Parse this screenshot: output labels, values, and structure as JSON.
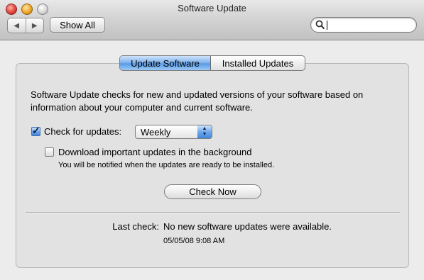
{
  "window": {
    "title": "Software Update"
  },
  "toolbar": {
    "back_icon": "back-arrow-icon",
    "forward_icon": "forward-arrow-icon",
    "show_all_label": "Show All",
    "search": {
      "value": "",
      "placeholder": "",
      "icon": "magnifier-icon"
    }
  },
  "tabs": [
    {
      "label": "Update Software",
      "selected": true
    },
    {
      "label": "Installed Updates",
      "selected": false
    }
  ],
  "main": {
    "description": "Software Update checks for new and updated versions of your software based on information about your computer and current software.",
    "check_for_updates": {
      "label": "Check for updates:",
      "checked": true
    },
    "frequency": {
      "selected": "Weekly"
    },
    "download_background": {
      "label": "Download important updates in the background",
      "checked": false
    },
    "download_note": "You will be notified when the updates are ready to be installed.",
    "check_now_label": "Check Now",
    "last_check_label": "Last check:",
    "last_check_value": "No new software updates were available.",
    "last_check_date": "05/05/08 9:08 AM"
  },
  "colors": {
    "accent_blue": "#5a9be6",
    "window_bg": "#ececec",
    "close_red": "#e0443b",
    "minimize_yellow": "#f0a62a"
  }
}
